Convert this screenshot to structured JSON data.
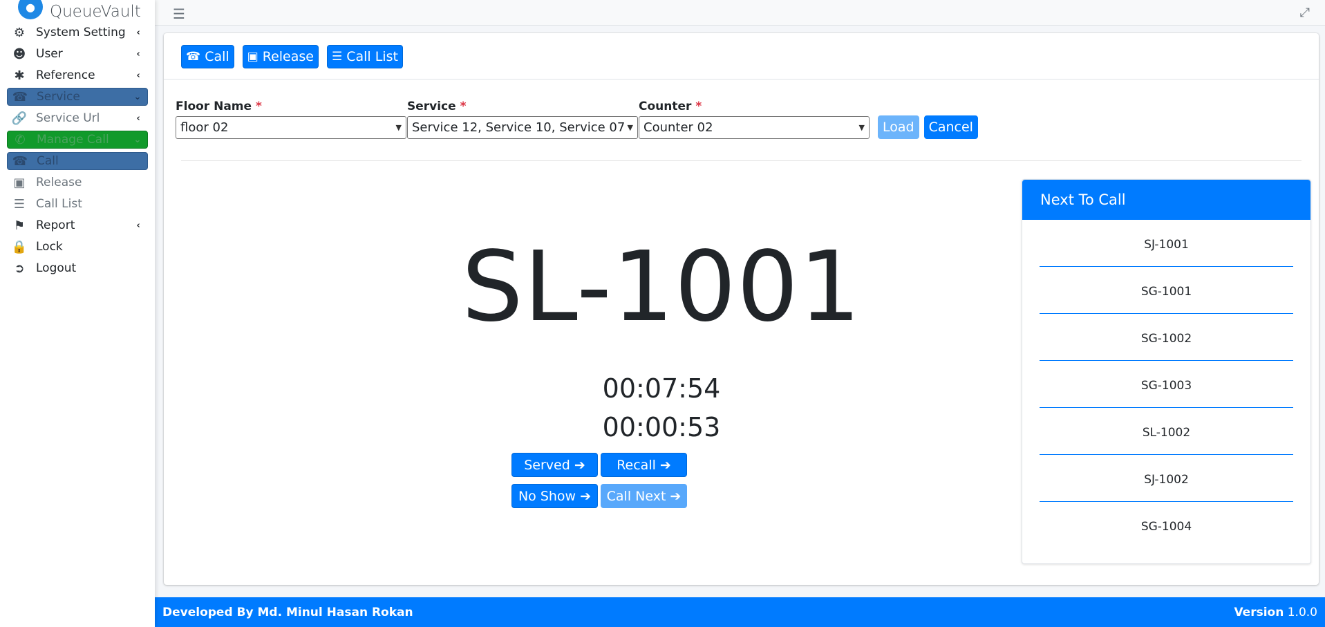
{
  "brand": {
    "name": "QueueVault"
  },
  "sidebar": {
    "items": [
      {
        "label": "System Setting",
        "icon": "gear-icon"
      },
      {
        "label": "User",
        "icon": "users-icon"
      },
      {
        "label": "Reference",
        "icon": "asterisk-icon"
      },
      {
        "label": "Service",
        "icon": "headset-icon"
      },
      {
        "label": "Service Url",
        "icon": "link-icon"
      },
      {
        "label": "Manage Call",
        "icon": "phone-icon"
      },
      {
        "label": "Call",
        "icon": "headset-icon"
      },
      {
        "label": "Release",
        "icon": "box-icon"
      },
      {
        "label": "Call List",
        "icon": "list-icon"
      },
      {
        "label": "Report",
        "icon": "flag-icon"
      },
      {
        "label": "Lock",
        "icon": "lock-icon"
      },
      {
        "label": "Logout",
        "icon": "logout-icon"
      }
    ]
  },
  "toolbar": {
    "call": "Call",
    "release": "Release",
    "call_list": "Call List"
  },
  "form": {
    "floor_label": "Floor Name",
    "floor_value": "floor 02",
    "service_label": "Service",
    "service_value": "Service 12, Service 10, Service 07",
    "counter_label": "Counter",
    "counter_value": "Counter 02",
    "required_mark": "*",
    "load": "Load",
    "cancel": "Cancel"
  },
  "current": {
    "token": "SL-1001",
    "timer_total": "00:07:54",
    "timer_current": "00:00:53"
  },
  "actions": {
    "served": "Served",
    "recall": "Recall",
    "no_show": "No Show",
    "call_next": "Call Next"
  },
  "next_to_call": {
    "title": "Next To Call",
    "items": [
      "SJ-1001",
      "SG-1001",
      "SG-1002",
      "SG-1003",
      "SL-1002",
      "SJ-1002",
      "SG-1004"
    ]
  },
  "footer": {
    "developer": "Developed By Md. Minul Hasan Rokan",
    "version_label": "Version",
    "version": "1.0.0"
  },
  "colors": {
    "primary": "#007bff",
    "active_blue": "#3d6ea5",
    "active_green": "#119a2b",
    "required": "#dc3545"
  }
}
